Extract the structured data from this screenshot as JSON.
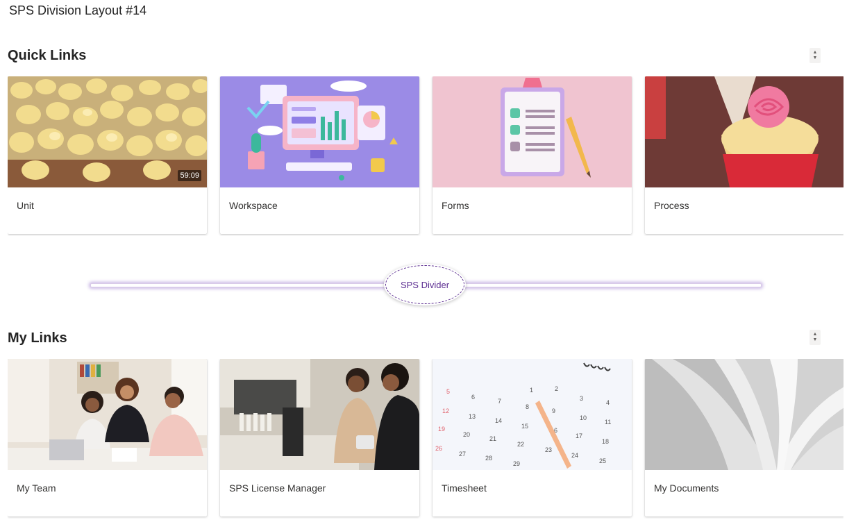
{
  "page": {
    "title": "SPS Division Layout #14"
  },
  "quick_links": {
    "title": "Quick Links",
    "items": [
      {
        "label": "Unit",
        "image": "chicks-photo",
        "duration": "59:09"
      },
      {
        "label": "Workspace",
        "image": "workspace-illustration"
      },
      {
        "label": "Forms",
        "image": "clipboard-illustration"
      },
      {
        "label": "Process",
        "image": "cupcake-photo"
      }
    ]
  },
  "divider": {
    "label": "SPS Divider",
    "accent": "#5c2e91"
  },
  "my_links": {
    "title": "My Links",
    "items": [
      {
        "label": "My Team",
        "image": "team-photo"
      },
      {
        "label": "SPS License Manager",
        "image": "shop-photo"
      },
      {
        "label": "Timesheet",
        "image": "calendar-photo"
      },
      {
        "label": "My Documents",
        "image": "book-photo"
      }
    ]
  },
  "colors": {
    "accent": "#5c2e91",
    "text": "#323130"
  }
}
